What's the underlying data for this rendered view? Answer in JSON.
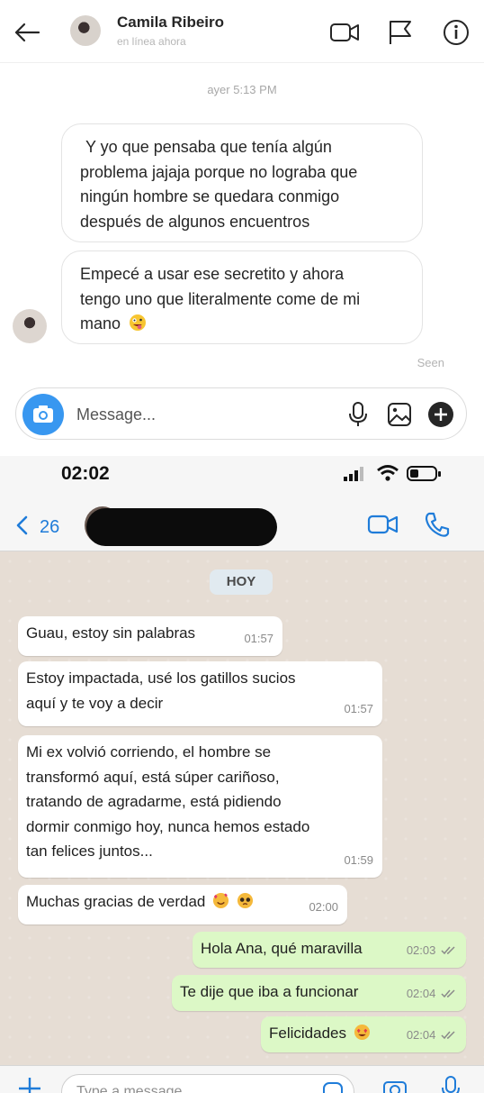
{
  "instagram": {
    "contact_name": "Camila Ribeiro",
    "status": "en línea ahora",
    "timestamp": "ayer 5:13 PM",
    "messages": [
      {
        "lines": [
          "Y yo que pensaba que tenía algún",
          "problema jajaja porque no lograba que",
          "ningún hombre se quedara conmigo",
          "después de algunos encuentros"
        ]
      },
      {
        "lines": [
          "Empecé a usar ese secretito y ahora",
          "tengo uno que literalmente come de mi",
          "mano"
        ],
        "emoji": "zany-face"
      }
    ],
    "seen_label": "Seen",
    "input_placeholder": "Message...",
    "icons": [
      "back-arrow-icon",
      "video-icon",
      "flag-icon",
      "info-icon",
      "camera-icon",
      "microphone-icon",
      "image-icon",
      "plus-icon"
    ],
    "accent_color": "#3897f0"
  },
  "whatsapp": {
    "clock": "02:02",
    "back_count": "26",
    "day_label": "HOY",
    "incoming": [
      {
        "lines": [
          "Guau, estoy sin palabras"
        ],
        "time": "01:57"
      },
      {
        "lines": [
          "Estoy impactada, usé los gatillos sucios",
          "aquí y te voy a decir"
        ],
        "time": "01:57"
      },
      {
        "lines": [
          "Mi ex volvió corriendo, el hombre se",
          "transformó aquí, está súper cariñoso,",
          "tratando de agradarme, está pidiendo",
          "dormir conmigo hoy, nunca hemos estado",
          "tan felices juntos..."
        ],
        "time": "01:59"
      },
      {
        "lines": [
          "Muchas gracias de verdad"
        ],
        "time": "02:00",
        "emojis": [
          "smiling-face-with-hearts",
          "pleading-face"
        ]
      }
    ],
    "outgoing": [
      {
        "text": "Hola Ana, qué maravilla",
        "time": "02:03"
      },
      {
        "text": "Te dije que iba a funcionar",
        "time": "02:04"
      },
      {
        "text": "Felicidades",
        "time": "02:04",
        "emoji": "heart-eyes-face"
      }
    ],
    "input_placeholder": "Type a message",
    "colors": {
      "link": "#1f7cd9",
      "outgoing_bubble": "#dcf8c6",
      "chat_bg": "#e6ddd4"
    }
  }
}
